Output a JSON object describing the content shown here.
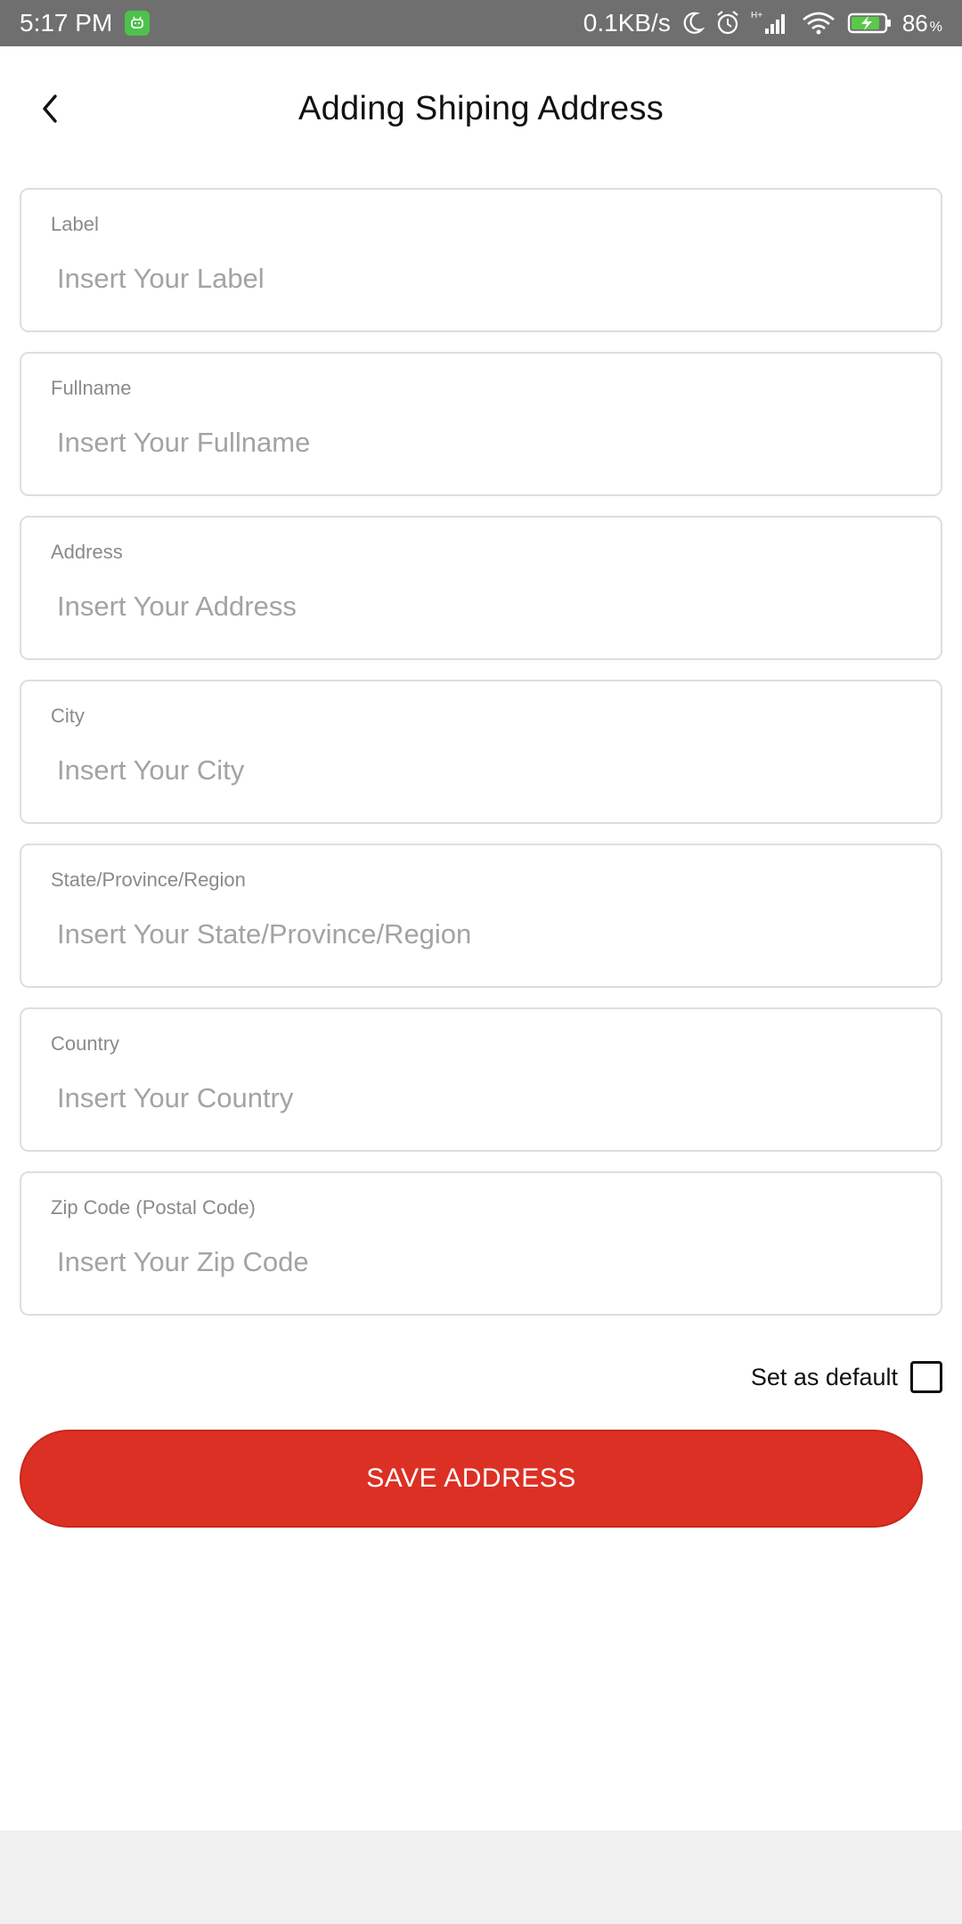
{
  "status_bar": {
    "time": "5:17 PM",
    "net_speed": "0.1KB/s",
    "network_type": "H+",
    "battery_level": "86",
    "battery_unit": "%",
    "icons": [
      "android-notification-icon",
      "moon-icon",
      "alarm-icon",
      "signal-icon",
      "wifi-icon",
      "battery-charging-icon"
    ]
  },
  "header": {
    "title": "Adding Shiping Address",
    "back_icon": "chevron-left-icon"
  },
  "fields": [
    {
      "label": "Label",
      "placeholder": "Insert Your Label",
      "value": ""
    },
    {
      "label": "Fullname",
      "placeholder": "Insert Your Fullname",
      "value": ""
    },
    {
      "label": "Address",
      "placeholder": "Insert Your Address",
      "value": ""
    },
    {
      "label": "City",
      "placeholder": "Insert Your City",
      "value": ""
    },
    {
      "label": "State/Province/Region",
      "placeholder": "Insert Your State/Province/Region",
      "value": ""
    },
    {
      "label": "Country",
      "placeholder": "Insert Your Country",
      "value": ""
    },
    {
      "label": "Zip Code (Postal Code)",
      "placeholder": "Insert Your Zip Code",
      "value": ""
    }
  ],
  "default_option": {
    "label": "Set as default",
    "checked": false
  },
  "save_button": {
    "label": "SAVE ADDRESS"
  },
  "colors": {
    "accent": "#dc3024",
    "status_bar": "#6f6f6f",
    "field_border": "#dedede",
    "placeholder": "#a3a3a3",
    "label": "#8a8a8a"
  }
}
